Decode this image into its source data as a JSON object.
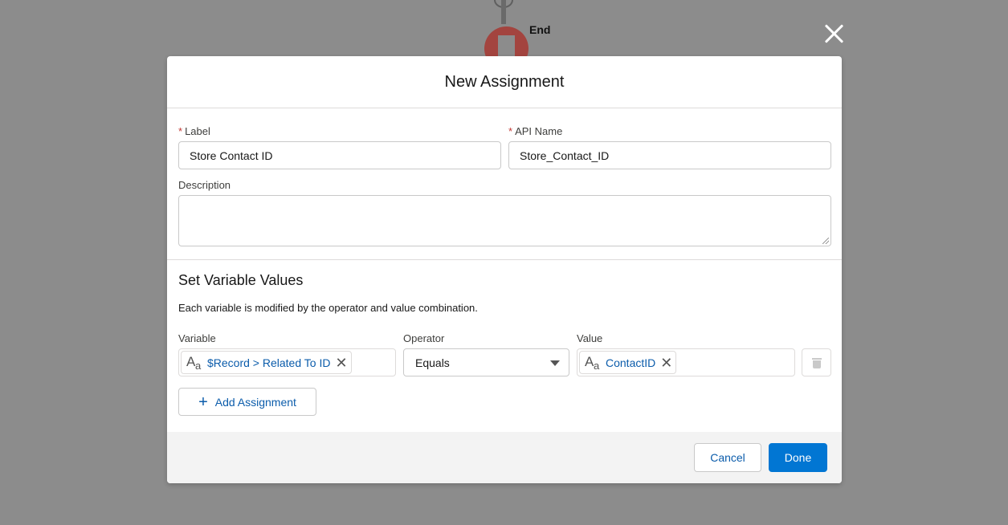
{
  "canvas": {
    "end_label": "End"
  },
  "modal": {
    "title": "New Assignment",
    "label_field": {
      "label": "Label",
      "value": "Store Contact ID"
    },
    "api_name_field": {
      "label": "API Name",
      "value": "Store_Contact_ID"
    },
    "description_field": {
      "label": "Description",
      "value": ""
    },
    "required_marker": "*",
    "variables": {
      "title": "Set Variable Values",
      "description": "Each variable is modified by the operator and value combination.",
      "headers": {
        "variable": "Variable",
        "operator": "Operator",
        "value": "Value"
      },
      "rows": [
        {
          "variable": "$Record > Related To ID",
          "operator": "Equals",
          "value": "ContactID"
        }
      ],
      "add_label": "Add Assignment"
    },
    "footer": {
      "cancel": "Cancel",
      "done": "Done"
    }
  },
  "colors": {
    "brand_blue": "#0176d3",
    "link_blue": "#0b5cab",
    "required_red": "#c23934",
    "end_node": "#a3443f"
  },
  "icons": {
    "close": "close-icon",
    "text_type": "text-type-icon",
    "remove": "remove-icon",
    "trash": "trash-icon",
    "add": "plus-icon",
    "dropdown": "chevron-down-icon"
  }
}
